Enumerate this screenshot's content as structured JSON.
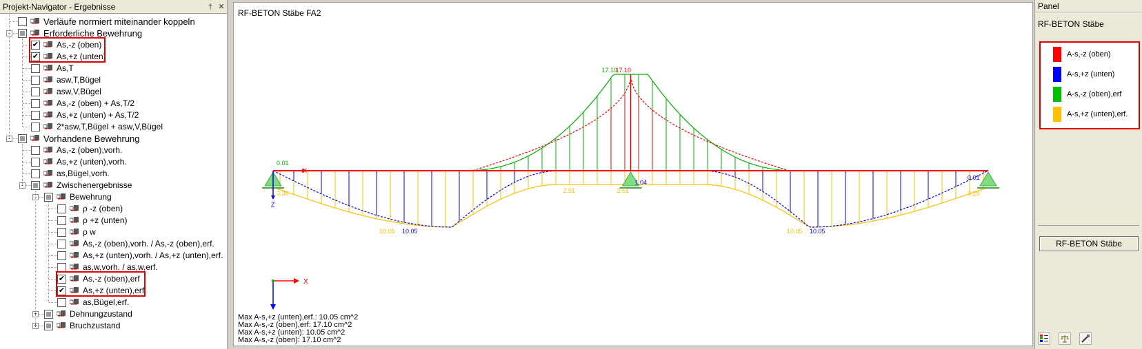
{
  "navigator": {
    "title": "Projekt-Navigator - Ergebnisse",
    "pin": "†",
    "close": "✕",
    "items": [
      {
        "label": "Verläufe normiert miteinander koppeln",
        "checked": false
      },
      {
        "label": "Erforderliche Bewehrung",
        "state": "partial"
      },
      {
        "label": "As,-z (oben)",
        "checked": true
      },
      {
        "label": "As,+z (unten)",
        "checked": true
      },
      {
        "label": "As,T",
        "checked": false
      },
      {
        "label": "asw,T,Bügel",
        "checked": false
      },
      {
        "label": "asw,V,Bügel",
        "checked": false
      },
      {
        "label": "As,-z (oben) + As,T/2",
        "checked": false
      },
      {
        "label": "As,+z (unten) + As,T/2",
        "checked": false
      },
      {
        "label": "2*asw,T,Bügel + asw,V,Bügel",
        "checked": false
      },
      {
        "label": "Vorhandene Bewehrung",
        "state": "partial"
      },
      {
        "label": "As,-z (oben),vorh.",
        "checked": false
      },
      {
        "label": "As,+z (unten),vorh.",
        "checked": false
      },
      {
        "label": "as,Bügel,vorh.",
        "checked": false
      },
      {
        "label": "Zwischenergebnisse",
        "state": "partial"
      },
      {
        "label": "Bewehrung",
        "state": "partial"
      },
      {
        "label": "ρ -z (oben)",
        "checked": false
      },
      {
        "label": "ρ +z (unten)",
        "checked": false
      },
      {
        "label": "ρ w",
        "checked": false
      },
      {
        "label": "As,-z (oben),vorh. / As,-z (oben),erf.",
        "checked": false
      },
      {
        "label": "As,+z (unten),vorh. / As,+z (unten),erf.",
        "checked": false
      },
      {
        "label": "as,w,vorh. / as,w,erf.",
        "checked": false
      },
      {
        "label": "As,-z (oben),erf",
        "checked": true
      },
      {
        "label": "As,+z (unten),erf.",
        "checked": true
      },
      {
        "label": "as,Bügel,erf.",
        "checked": false
      },
      {
        "label": "Dehnungzustand",
        "state": "partial"
      },
      {
        "label": "Bruchzustand",
        "state": "partial"
      }
    ]
  },
  "view": {
    "title": "RF-BETON Stäbe FA2",
    "axis_x": "X",
    "axis_z": "Z",
    "max_lines": [
      "Max A-s,+z (unten),erf.: 10.05 cm^2",
      "Max A-s,-z (oben),erf: 17.10 cm^2",
      "Max A-s,+z (unten): 10.05 cm^2",
      "Max A-s,-z (oben): 17.10 cm^2"
    ],
    "labels": {
      "top_green": "17.10",
      "top_red": "17.10",
      "left_green": "0.01",
      "left_orange": "3.30",
      "right_blue": "0.01",
      "right_orange": "3.29",
      "mid_orange_l": "2.51",
      "mid_orange_r": "2.51",
      "mid_blue": "1.04",
      "span1_orange": "10.05",
      "span1_blue": "10.05",
      "span2_orange": "10.05",
      "span2_blue": "10.05"
    },
    "colors": {
      "red": "#ff0000",
      "blue": "#0000ff",
      "green": "#00b000",
      "orange": "#ffc000"
    }
  },
  "panel": {
    "title": "Panel",
    "subtitle": "RF-BETON Stäbe",
    "legend": [
      {
        "label": "A-s,-z (oben)",
        "color": "#ff0000"
      },
      {
        "label": "A-s,+z (unten)",
        "color": "#0000ff"
      },
      {
        "label": "A-s,-z (oben),erf",
        "color": "#00c000"
      },
      {
        "label": "A-s,+z (unten),erf.",
        "color": "#ffc000"
      }
    ],
    "button": "RF-BETON Stäbe"
  }
}
